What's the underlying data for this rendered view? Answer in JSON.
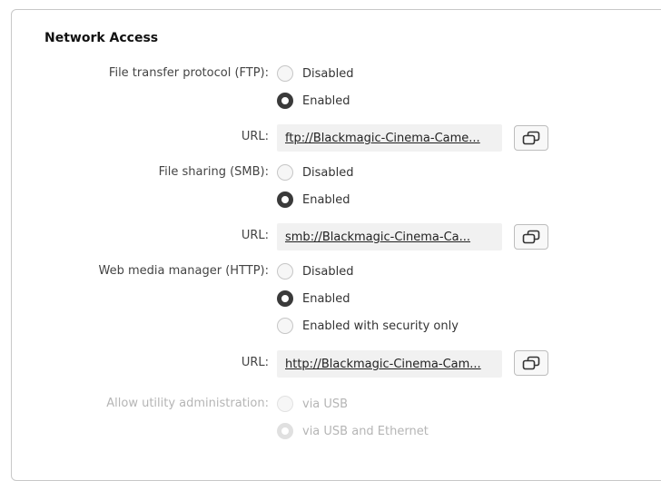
{
  "section": {
    "title": "Network Access"
  },
  "ftp": {
    "label": "File transfer protocol (FTP):",
    "options": [
      "Disabled",
      "Enabled"
    ],
    "selected": "Enabled",
    "url_label": "URL:",
    "url": "ftp://Blackmagic-Cinema-Came..."
  },
  "smb": {
    "label": "File sharing (SMB):",
    "options": [
      "Disabled",
      "Enabled"
    ],
    "selected": "Enabled",
    "url_label": "URL:",
    "url": "smb://Blackmagic-Cinema-Ca..."
  },
  "http": {
    "label": "Web media manager (HTTP):",
    "options": [
      "Disabled",
      "Enabled",
      "Enabled with security only"
    ],
    "selected": "Enabled",
    "url_label": "URL:",
    "url": "http://Blackmagic-Cinema-Cam..."
  },
  "utility": {
    "label": "Allow utility administration:",
    "options": [
      "via USB",
      "via USB and Ethernet"
    ],
    "selected": "via USB and Ethernet",
    "enabled": false
  },
  "icons": {
    "copy": "copy-icon",
    "radio": "radio-button"
  },
  "colors": {
    "accent": "#3a3a3a",
    "disabled_text": "#b5b5b5",
    "url_background": "#f1f1f1"
  }
}
